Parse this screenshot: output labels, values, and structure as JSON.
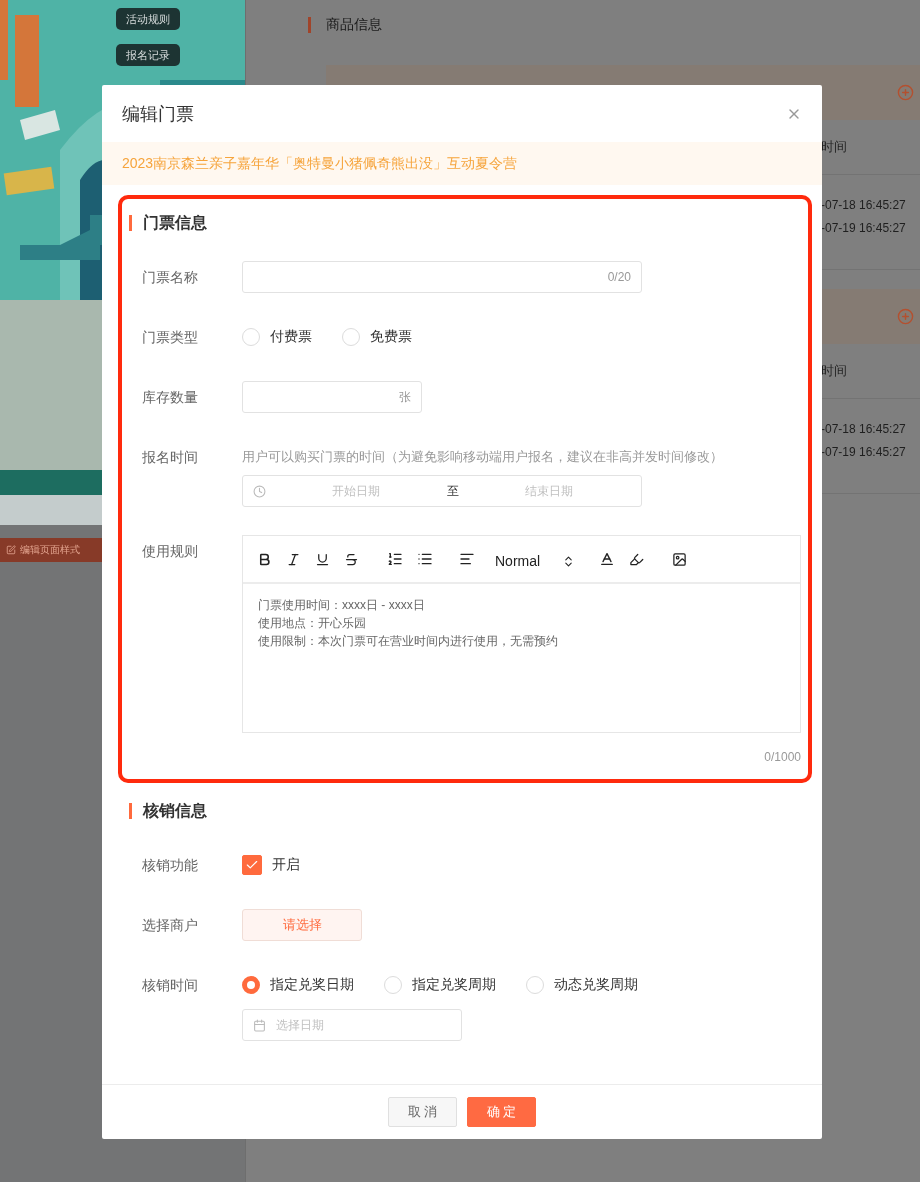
{
  "background": {
    "side_panel": {
      "buttons": [
        "活动规则",
        "报名记录"
      ],
      "edit_button": "编辑页面样式"
    },
    "main": {
      "section_title": "商品信息",
      "tables": [
        {
          "header": "时间",
          "rows": [
            "-07-18 16:45:27",
            "-07-19 16:45:27"
          ]
        },
        {
          "header": "时间",
          "rows": [
            "-07-18 16:45:27",
            "-07-19 16:45:27"
          ]
        }
      ]
    }
  },
  "dialog": {
    "title": "编辑门票",
    "notice": "2023南京森兰亲子嘉年华「奥特曼小猪佩奇熊出没」互动夏令营",
    "sections": [
      {
        "title": "门票信息",
        "highlighted": true,
        "fields": [
          {
            "kind": "text",
            "label": "门票名称",
            "counter": "0/20"
          },
          {
            "kind": "radio",
            "label": "门票类型",
            "options": [
              {
                "label": "付费票",
                "selected": false
              },
              {
                "label": "免费票",
                "selected": false
              }
            ]
          },
          {
            "kind": "number",
            "label": "库存数量",
            "suffix": "张"
          },
          {
            "kind": "daterange",
            "label": "报名时间",
            "hint": "用户可以购买门票的时间（为避免影响移动端用户报名，建议在非高并发时间修改）",
            "start_placeholder": "开始日期",
            "separator": "至",
            "end_placeholder": "结束日期"
          },
          {
            "kind": "editor",
            "label": "使用规则",
            "heading_format": "Normal",
            "lines": [
              "门票使用时间：xxxx日 - xxxx日",
              "使用地点：开心乐园",
              "使用限制：本次门票可在营业时间内进行使用，无需预约"
            ],
            "counter": "0/1000"
          }
        ]
      },
      {
        "title": "核销信息",
        "highlighted": false,
        "fields": [
          {
            "kind": "checkbox",
            "label": "核销功能",
            "option": "开启",
            "checked": true
          },
          {
            "kind": "select",
            "label": "选择商户",
            "button": "请选择"
          },
          {
            "kind": "radio",
            "label": "核销时间",
            "options": [
              {
                "label": "指定兑奖日期",
                "selected": true
              },
              {
                "label": "指定兑奖周期",
                "selected": false
              },
              {
                "label": "动态兑奖周期",
                "selected": false
              }
            ],
            "date_placeholder": "选择日期"
          }
        ]
      }
    ],
    "buttons": [
      {
        "label": "取 消",
        "kind": "secondary"
      },
      {
        "label": "确 定",
        "kind": "primary"
      }
    ]
  }
}
